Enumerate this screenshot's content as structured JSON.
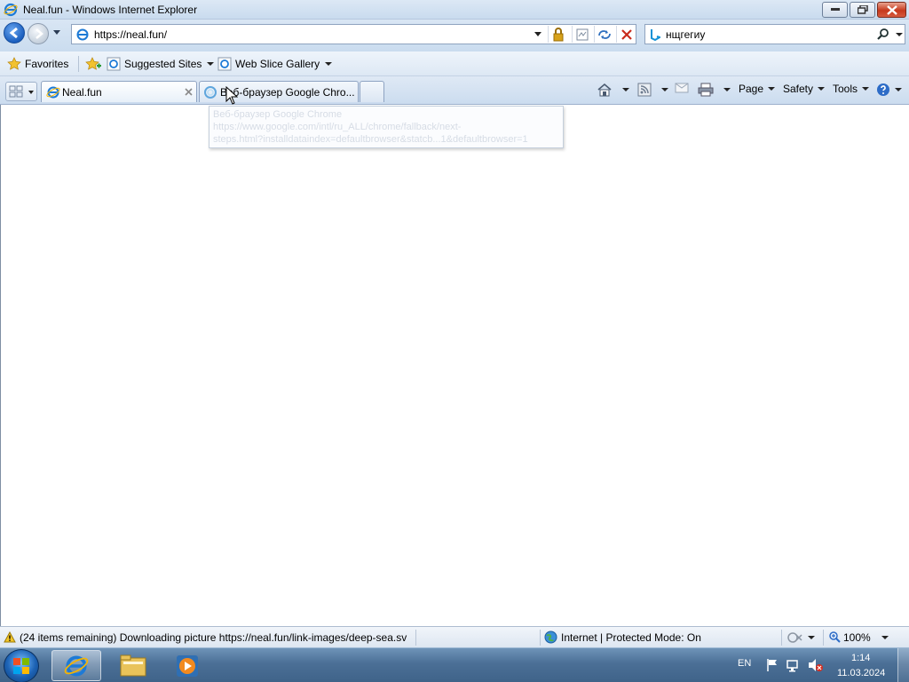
{
  "window": {
    "title": "Neal.fun - Windows Internet Explorer"
  },
  "nav": {
    "url": "https://neal.fun/",
    "search_value": "нщгегиу"
  },
  "favorites_bar": {
    "favorites": "Favorites",
    "suggested": "Suggested Sites",
    "web_slice": "Web Slice Gallery"
  },
  "tabs": [
    {
      "label": "Neal.fun"
    },
    {
      "label": "Веб-браузер Google Chro..."
    }
  ],
  "tooltip": {
    "line1": "Веб-браузер Google Chrome",
    "line2": "https://www.google.com/intl/ru_ALL/chrome/fallback/next-",
    "line3": "steps.html?installdataindex=defaultbrowser&statcb...1&defaultbrowser=1"
  },
  "command_bar": {
    "page": "Page",
    "safety": "Safety",
    "tools": "Tools"
  },
  "status": {
    "text": "(24 items remaining) Downloading picture https://neal.fun/link-images/deep-sea.sv",
    "zone": "Internet | Protected Mode: On",
    "zoom": "100%"
  },
  "taskbar": {
    "lang": "EN",
    "time": "1:14",
    "date": "11.03.2024"
  },
  "icons": [
    "ie-icon",
    "back-icon",
    "forward-icon",
    "lock-icon",
    "compat-view-icon",
    "refresh-icon",
    "stop-icon",
    "bing-icon",
    "search-icon",
    "favorites-star-icon",
    "add-favorites-icon",
    "quick-tabs-icon",
    "home-icon",
    "feeds-icon",
    "read-mail-icon",
    "print-icon",
    "help-icon",
    "warning-icon",
    "globe-icon",
    "windows-start-icon",
    "explorer-folder-icon",
    "media-player-icon",
    "flag-icon",
    "network-icon",
    "volume-muted-icon"
  ]
}
